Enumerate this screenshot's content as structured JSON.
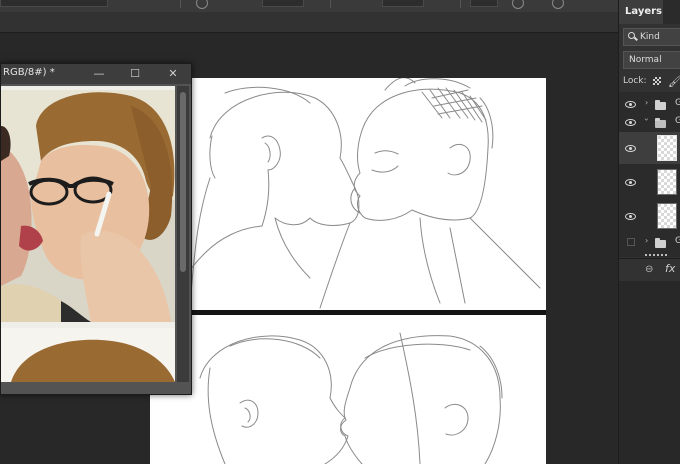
{
  "reference_window": {
    "title": "RGB/8#) *",
    "minimize_glyph": "—",
    "maximize_glyph": "☐",
    "close_glyph": "✕"
  },
  "layers_panel": {
    "tab_label": "Layers",
    "filter_kind": "Kind",
    "blend_mode": "Normal",
    "lock_label": "Lock:",
    "layers": [
      {
        "type": "group",
        "name": "G",
        "expanded": false,
        "visible": true
      },
      {
        "type": "group",
        "name": "G",
        "expanded": true,
        "visible": true
      },
      {
        "type": "layer",
        "name": "",
        "visible": true,
        "selected": true
      },
      {
        "type": "layer",
        "name": "",
        "visible": true,
        "selected": false
      },
      {
        "type": "layer",
        "name": "",
        "visible": true,
        "selected": false
      },
      {
        "type": "group",
        "name": "G",
        "expanded": false,
        "visible": false
      }
    ],
    "footer": {
      "link_icon": "link-icon",
      "fx_label": "fx"
    }
  },
  "icons": {
    "eye": "eye-icon",
    "folder": "folder-icon",
    "search": "search-icon",
    "brush": "brush-icon",
    "checker": "lock-pixels-icon"
  },
  "colors": {
    "app_background": "#282828",
    "panel_background": "#323232",
    "canvas": "#ffffff",
    "panel_divider": "#141414"
  }
}
